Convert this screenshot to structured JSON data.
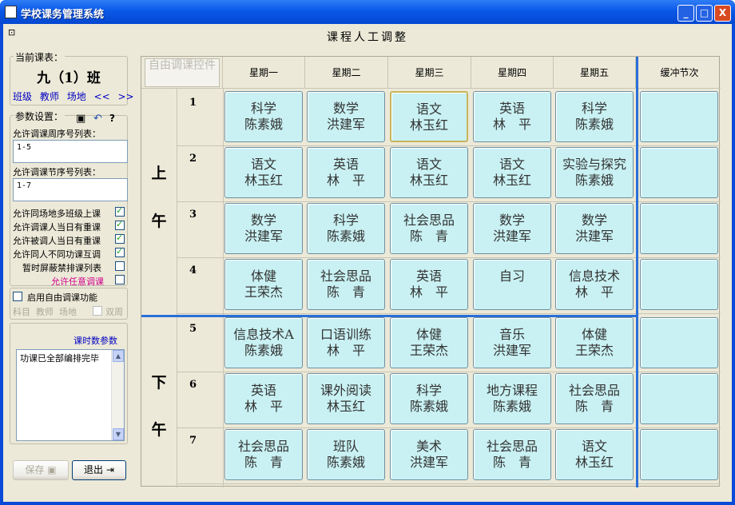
{
  "window": {
    "title": "学校课务管理系统",
    "minimize": "_",
    "maximize": "□",
    "close": "X"
  },
  "heading": "课程人工调整",
  "left": {
    "current_group": "当前课表：",
    "class_name": "九（1）班",
    "links": [
      "班级",
      "教师",
      "场地",
      "<<",
      ">>"
    ],
    "params_group": "参数设置：",
    "week_label": "允许调课周序号列表：",
    "week_value": "1-5",
    "period_label": "允许调课节序号列表：",
    "period_value": "1-7",
    "options": [
      {
        "label": "允许同场地多班级上课",
        "checked": true
      },
      {
        "label": "允许调课人当日有重课",
        "checked": true
      },
      {
        "label": "允许被调人当日有重课",
        "checked": true
      },
      {
        "label": "允许同人不同功课互调",
        "checked": true
      },
      {
        "label": "暂时屏蔽禁排课列表",
        "checked": false
      },
      {
        "label": "允许任意调课",
        "checked": false,
        "color": "#d0008c"
      }
    ],
    "free_toggle": "启用自由调课功能",
    "free_sub": [
      "科目",
      "教师",
      "场地"
    ],
    "double_week": "双周",
    "hours_title": "课时数参数",
    "hours_text": "功课已全部编排完毕",
    "save": "保存",
    "exit": "退出"
  },
  "grid": {
    "ghost_button": "自由调课控件",
    "days": [
      "星期一",
      "星期二",
      "星期三",
      "星期四",
      "星期五"
    ],
    "buffer": "缓冲节次",
    "morning": [
      "上",
      "午"
    ],
    "afternoon": [
      "下",
      "午"
    ],
    "periods": [
      "1",
      "2",
      "3",
      "4",
      "5",
      "6",
      "7"
    ],
    "rows": [
      [
        [
          "科学",
          "陈素娥"
        ],
        [
          "数学",
          "洪建军"
        ],
        [
          "语文",
          "林玉红"
        ],
        [
          "英语",
          "林　平"
        ],
        [
          "科学",
          "陈素娥"
        ]
      ],
      [
        [
          "语文",
          "林玉红"
        ],
        [
          "英语",
          "林　平"
        ],
        [
          "语文",
          "林玉红"
        ],
        [
          "语文",
          "林玉红"
        ],
        [
          "实验与探究",
          "陈素娥"
        ]
      ],
      [
        [
          "数学",
          "洪建军"
        ],
        [
          "科学",
          "陈素娥"
        ],
        [
          "社会思品",
          "陈　青"
        ],
        [
          "数学",
          "洪建军"
        ],
        [
          "数学",
          "洪建军"
        ]
      ],
      [
        [
          "体健",
          "王荣杰"
        ],
        [
          "社会思品",
          "陈　青"
        ],
        [
          "英语",
          "林　平"
        ],
        [
          "自习",
          ""
        ],
        [
          "信息技术",
          "林　平"
        ]
      ],
      [
        [
          "信息技术A",
          "陈素娥"
        ],
        [
          "口语训练",
          "林　平"
        ],
        [
          "体健",
          "王荣杰"
        ],
        [
          "音乐",
          "洪建军"
        ],
        [
          "体健",
          "王荣杰"
        ]
      ],
      [
        [
          "英语",
          "林　平"
        ],
        [
          "课外阅读",
          "林玉红"
        ],
        [
          "科学",
          "陈素娥"
        ],
        [
          "地方课程",
          "陈素娥"
        ],
        [
          "社会思品",
          "陈　青"
        ]
      ],
      [
        [
          "社会思品",
          "陈　青"
        ],
        [
          "班队",
          "陈素娥"
        ],
        [
          "美术",
          "洪建军"
        ],
        [
          "社会思品",
          "陈　青"
        ],
        [
          "语文",
          "林玉红"
        ]
      ]
    ]
  }
}
